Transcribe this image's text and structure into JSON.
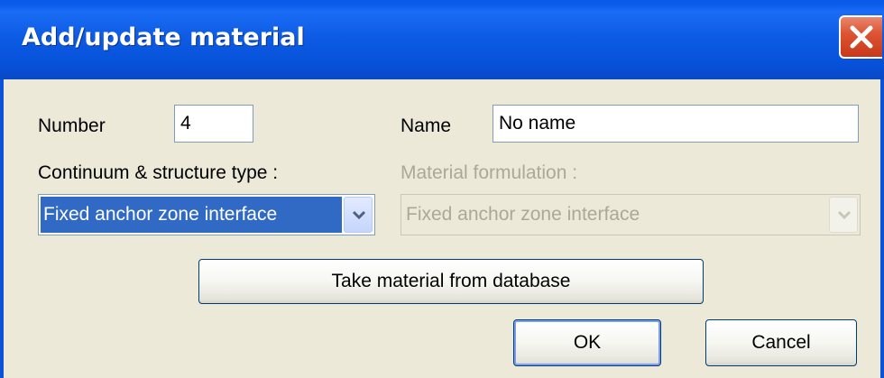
{
  "window": {
    "title": "Add/update material"
  },
  "form": {
    "number_label": "Number",
    "number_value": "4",
    "name_label": "Name",
    "name_value": "No name",
    "continuum_label": "Continuum & structure type :",
    "continuum_value": "Fixed anchor zone interface",
    "formulation_label": "Material formulation :",
    "formulation_value": "Fixed anchor zone interface"
  },
  "buttons": {
    "database": "Take material from database",
    "ok": "OK",
    "cancel": "Cancel"
  },
  "colors": {
    "titlebar": "#0a5ce6",
    "dialog_bg": "#ece9d8",
    "selection": "#316ac5",
    "close_button": "#dd5534",
    "disabled_text": "#aca899"
  }
}
